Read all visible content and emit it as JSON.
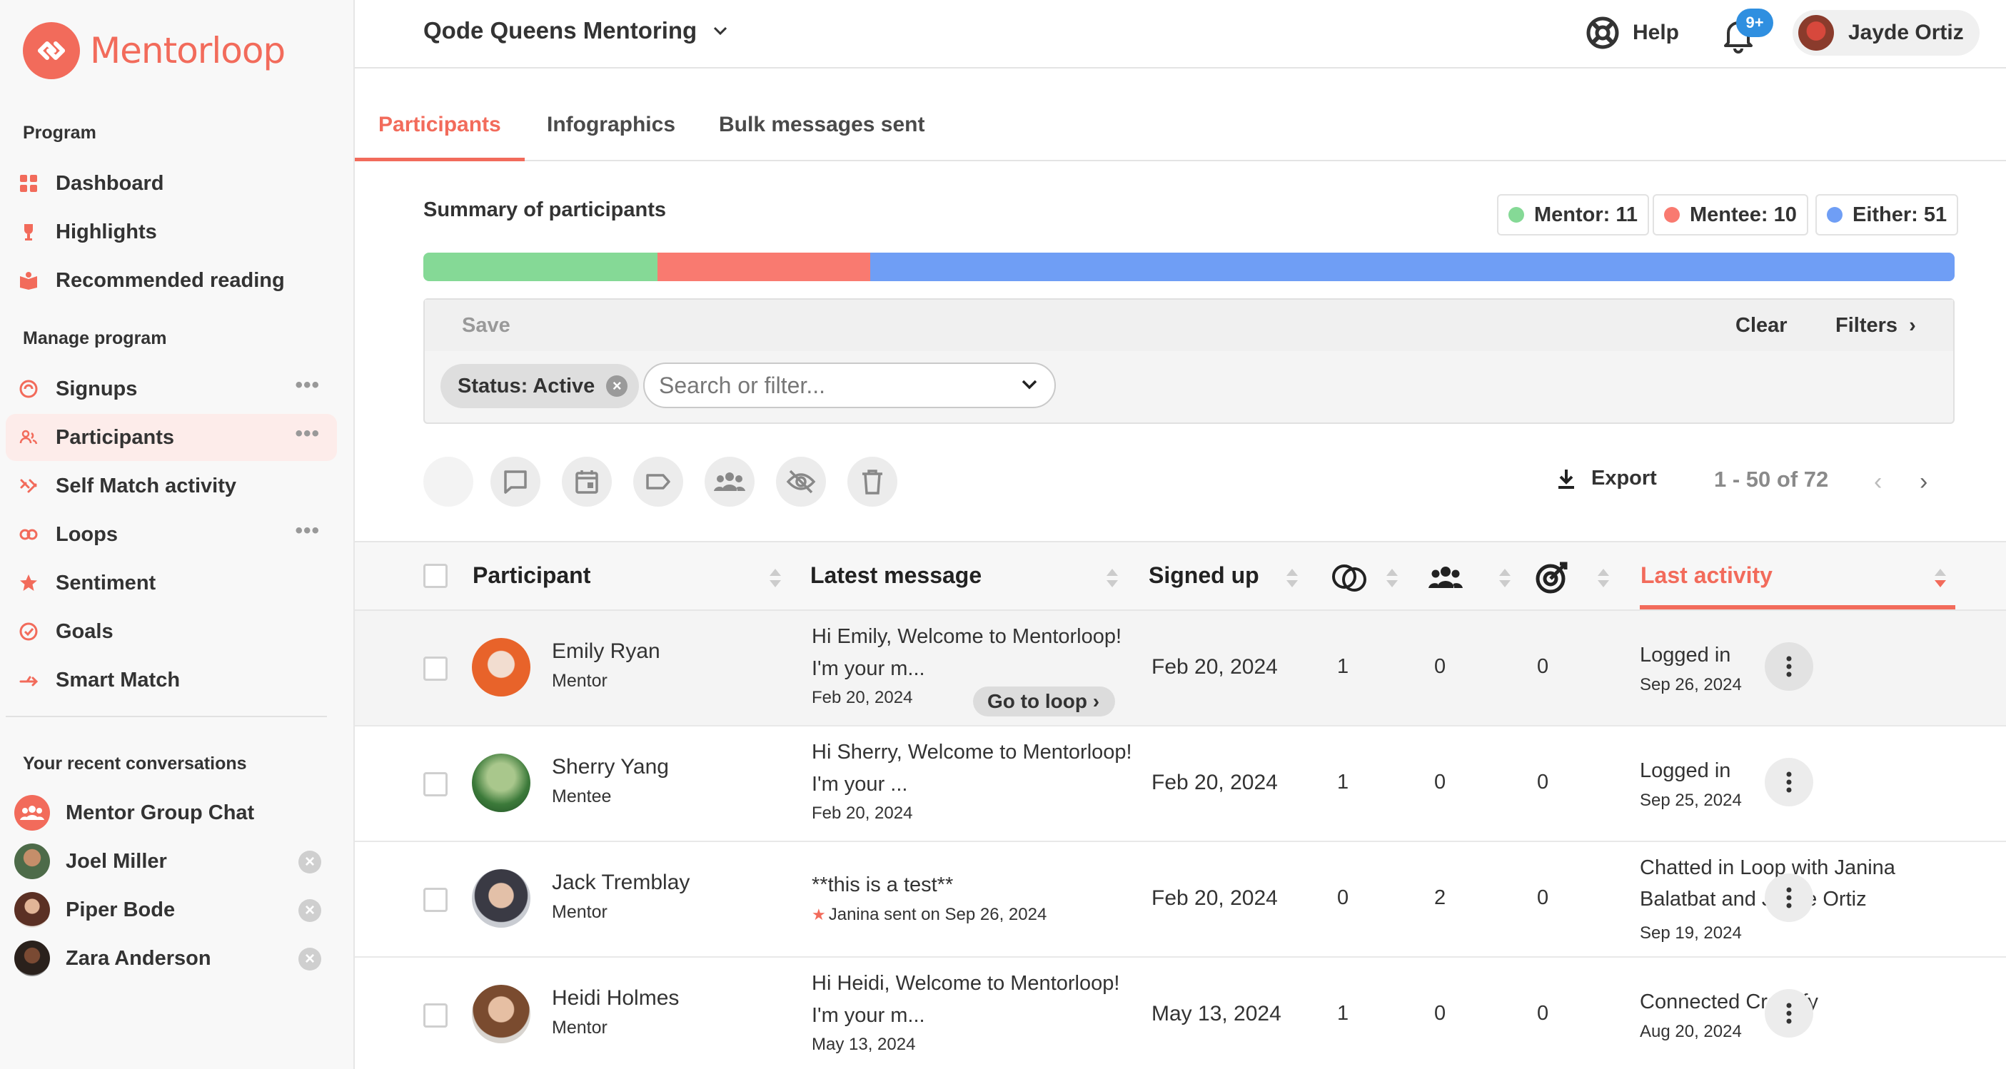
{
  "brand": {
    "name": "Mentorloop"
  },
  "sidebar": {
    "program_title": "Program",
    "program_items": [
      {
        "label": "Dashboard",
        "icon": "grid-icon"
      },
      {
        "label": "Highlights",
        "icon": "trophy-icon"
      },
      {
        "label": "Recommended reading",
        "icon": "book-icon"
      }
    ],
    "manage_title": "Manage program",
    "manage_items": [
      {
        "label": "Signups",
        "icon": "signup-icon"
      },
      {
        "label": "Participants",
        "icon": "people-icon"
      },
      {
        "label": "Self Match activity",
        "icon": "self-match-icon"
      },
      {
        "label": "Loops",
        "icon": "loop-icon"
      },
      {
        "label": "Sentiment",
        "icon": "star-icon"
      },
      {
        "label": "Goals",
        "icon": "goal-icon"
      },
      {
        "label": "Smart Match",
        "icon": "smart-match-icon"
      }
    ],
    "recent_title": "Your recent conversations",
    "conversations": [
      {
        "label": "Mentor Group Chat"
      },
      {
        "label": "Joel Miller"
      },
      {
        "label": "Piper Bode"
      },
      {
        "label": "Zara Anderson"
      }
    ]
  },
  "topbar": {
    "program": "Qode Queens Mentoring",
    "help": "Help",
    "notif_badge": "9+",
    "user": "Jayde Ortiz"
  },
  "tabs": [
    "Participants",
    "Infographics",
    "Bulk messages sent"
  ],
  "summary": {
    "title": "Summary of participants",
    "mentor": "Mentor: 11",
    "mentee": "Mentee: 10",
    "either": "Either: 51",
    "counts": {
      "mentor": 11,
      "mentee": 10,
      "either": 51
    },
    "colors": {
      "mentor": "#85d996",
      "mentee": "#f97a70",
      "either": "#6f9ef5"
    }
  },
  "filters": {
    "save": "Save",
    "clear": "Clear",
    "filters": "Filters",
    "chip": "Status: Active",
    "search_placeholder": "Search or filter..."
  },
  "toolbar": {
    "export": "Export",
    "range": "1 - 50 of 72"
  },
  "table": {
    "headers": {
      "participant": "Participant",
      "latest": "Latest message",
      "signed": "Signed up",
      "last": "Last activity"
    },
    "go_to_loop": "Go to loop",
    "rows": [
      {
        "name": "Emily Ryan",
        "role": "Mentor",
        "msg": "Hi Emily, Welcome to Mentorloop! I'm your m...",
        "msg_date": "Feb 20, 2024",
        "signed": "Feb 20, 2024",
        "n1": "1",
        "n2": "0",
        "n3": "0",
        "act": "Logged in",
        "act_date": "Sep 26, 2024"
      },
      {
        "name": "Sherry Yang",
        "role": "Mentee",
        "msg": "Hi Sherry, Welcome to Mentorloop! I'm your ...",
        "msg_date": "Feb 20, 2024",
        "signed": "Feb 20, 2024",
        "n1": "1",
        "n2": "0",
        "n3": "0",
        "act": "Logged in",
        "act_date": "Sep 25, 2024"
      },
      {
        "name": "Jack Tremblay",
        "role": "Mentor",
        "msg": "**this is a test**",
        "msg_date": "Janina sent on Sep 26, 2024",
        "signed": "Feb 20, 2024",
        "n1": "0",
        "n2": "2",
        "n3": "0",
        "act": "Chatted in Loop with Janina Balatbat and Jayde Ortiz",
        "act_date": "Sep 19, 2024"
      },
      {
        "name": "Heidi Holmes",
        "role": "Mentor",
        "msg": "Hi Heidi, Welcome to Mentorloop! I'm your m...",
        "msg_date": "May 13, 2024",
        "signed": "May 13, 2024",
        "n1": "1",
        "n2": "0",
        "n3": "0",
        "act": "Connected Cronofy",
        "act_date": "Aug 20, 2024"
      }
    ]
  }
}
